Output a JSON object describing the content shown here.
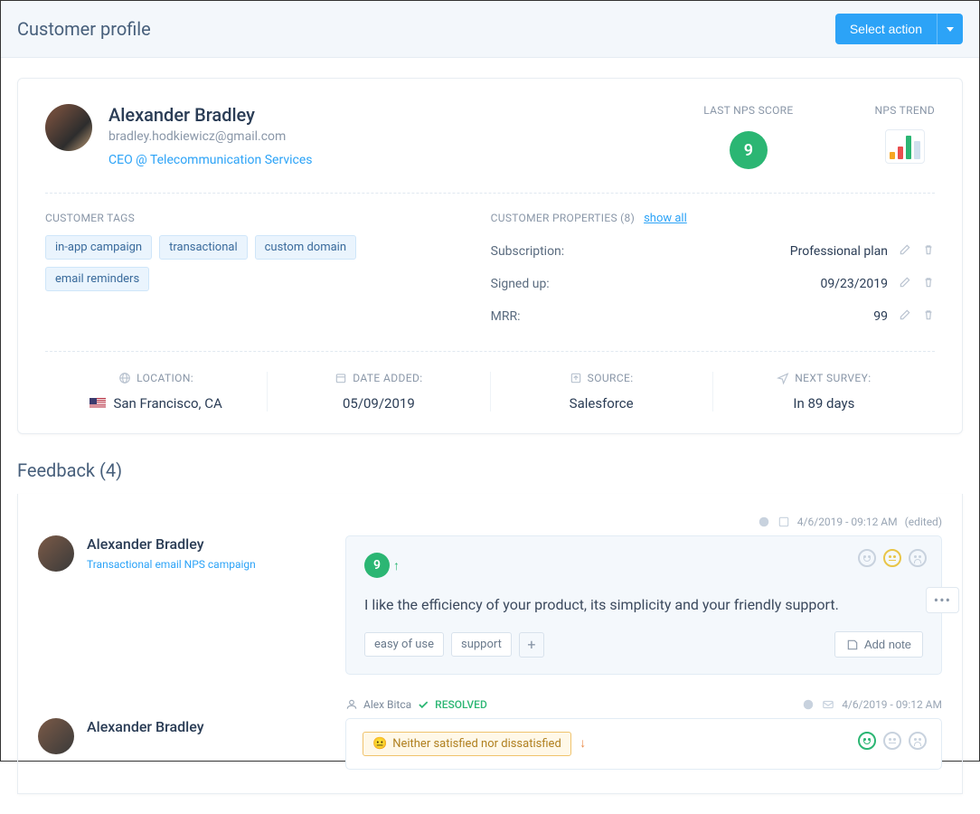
{
  "header": {
    "title": "Customer profile",
    "select_action": "Select action"
  },
  "profile": {
    "name": "Alexander Bradley",
    "email": "bradley.hodkiewicz@gmail.com",
    "role": "CEO @ Telecommunication Services",
    "last_nps_label": "LAST NPS SCORE",
    "last_nps_value": "9",
    "nps_trend_label": "NPS TREND"
  },
  "tags": {
    "label": "CUSTOMER TAGS",
    "items": [
      "in-app campaign",
      "transactional",
      "custom domain",
      "email reminders"
    ]
  },
  "properties": {
    "label": "CUSTOMER PROPERTIES (8)",
    "show_all": "show all",
    "rows": [
      {
        "key": "Subscription:",
        "value": "Professional plan"
      },
      {
        "key": "Signed up:",
        "value": "09/23/2019"
      },
      {
        "key": "MRR:",
        "value": "99"
      }
    ]
  },
  "meta": {
    "location_label": "LOCATION:",
    "location_value": "San Francisco, CA",
    "date_added_label": "DATE ADDED:",
    "date_added_value": "05/09/2019",
    "source_label": "SOURCE:",
    "source_value": "Salesforce",
    "next_survey_label": "NEXT SURVEY:",
    "next_survey_value": "In 89 days"
  },
  "feedback": {
    "header": "Feedback (4)",
    "items": [
      {
        "timestamp": "4/6/2019 - 09:12 AM",
        "edited": "(edited)",
        "author": "Alexander Bradley",
        "campaign": "Transactional email NPS campaign",
        "nps": "9",
        "text": "I like the efficiency of your product, its simplicity and your friendly support.",
        "tags": [
          "easy of use",
          "support"
        ],
        "add_note": "Add note"
      },
      {
        "assignee": "Alex Bitca",
        "status": "RESOLVED",
        "timestamp2": "4/6/2019 - 09:12 AM",
        "author": "Alexander Bradley",
        "satisfaction": "Neither satisfied nor dissatisfied"
      }
    ]
  }
}
